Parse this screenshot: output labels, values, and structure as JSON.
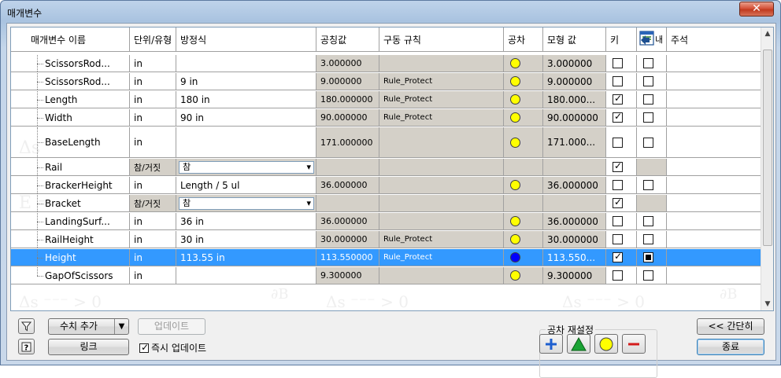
{
  "window": {
    "title": "매개변수",
    "close_label": "✕"
  },
  "grid": {
    "headers": {
      "name": "매개변수 이름",
      "unit": "단위/유형",
      "equation": "방정식",
      "nominal": "공칭값",
      "rule": "구동 규칙",
      "tolerance": "공차",
      "model": "모형 값",
      "key": "키",
      "export": "내",
      "comment": "주석"
    },
    "rows": [
      {
        "name": "ScissorsRod...",
        "unit": "in",
        "equation": "",
        "nominal": "3.000000",
        "rule": "",
        "tol": "yellow",
        "model": "3.000000",
        "key": "unchecked",
        "exp": "unchecked",
        "height": 22
      },
      {
        "name": "ScissorsRod...",
        "unit": "in",
        "equation": "9 in",
        "nominal": "9.000000",
        "rule": "Rule_Protect",
        "tol": "yellow",
        "model": "9.000000",
        "key": "unchecked",
        "exp": "unchecked",
        "height": 22
      },
      {
        "name": "Length",
        "unit": "in",
        "equation": "180 in",
        "nominal": "180.000000",
        "rule": "Rule_Protect",
        "tol": "yellow",
        "model": "180.000...",
        "key": "checked",
        "exp": "unchecked",
        "height": 22
      },
      {
        "name": "Width",
        "unit": "in",
        "equation": "90 in",
        "nominal": "90.000000",
        "rule": "Rule_Protect",
        "tol": "yellow",
        "model": "90.000000",
        "key": "checked",
        "exp": "unchecked",
        "height": 22
      },
      {
        "name": "BaseLength",
        "unit": "in",
        "equation": "",
        "nominal": "171.000000",
        "rule": "",
        "tol": "yellow",
        "model": "171.000...",
        "key": "unchecked",
        "exp": "unchecked",
        "height": 39
      },
      {
        "name": "Rail",
        "unit": "참/거짓",
        "equation": "참",
        "nominal": "",
        "rule": "",
        "tol": "",
        "model": "",
        "key": "checked",
        "exp": "",
        "height": 22,
        "dropdown": true
      },
      {
        "name": "BrackerHeight",
        "unit": "in",
        "equation": "Length / 5 ul",
        "nominal": "36.000000",
        "rule": "",
        "tol": "yellow",
        "model": "36.000000",
        "key": "unchecked",
        "exp": "unchecked",
        "height": 22
      },
      {
        "name": "Bracket",
        "unit": "참/거짓",
        "equation": "참",
        "nominal": "",
        "rule": "",
        "tol": "",
        "model": "",
        "key": "checked",
        "exp": "",
        "height": 22,
        "dropdown": true
      },
      {
        "name": "LandingSurf...",
        "unit": "in",
        "equation": "36 in",
        "nominal": "36.000000",
        "rule": "",
        "tol": "yellow",
        "model": "36.000000",
        "key": "unchecked",
        "exp": "unchecked",
        "height": 22
      },
      {
        "name": "RailHeight",
        "unit": "in",
        "equation": "30 in",
        "nominal": "30.000000",
        "rule": "Rule_Protect",
        "tol": "yellow",
        "model": "30.000000",
        "key": "unchecked",
        "exp": "unchecked",
        "height": 22
      },
      {
        "name": "Height",
        "unit": "in",
        "equation": "113.55 in",
        "nominal": "113.550000",
        "rule": "Rule_Protect",
        "tol": "blue",
        "model": "113.550...",
        "key": "checked",
        "exp": "filled",
        "height": 22,
        "selected": true
      },
      {
        "name": "GapOfScissors",
        "unit": "in",
        "equation": "",
        "nominal": "9.300000",
        "rule": "",
        "tol": "yellow",
        "model": "9.300000",
        "key": "unchecked",
        "exp": "unchecked",
        "height": 22
      }
    ]
  },
  "toolbar": {
    "add_numeric": "수치 추가",
    "update": "업데이트",
    "link": "링크",
    "immediate_update": "즉시 업데이트",
    "tolerance_reset": "공차 재설정",
    "less": "<< 간단히",
    "close": "종료"
  },
  "colors": {
    "selected_row": "#3399ff",
    "readonly_cell": "#d4d0c8",
    "tolerance_yellow": "#ffff00",
    "tolerance_blue": "#0000ff"
  }
}
